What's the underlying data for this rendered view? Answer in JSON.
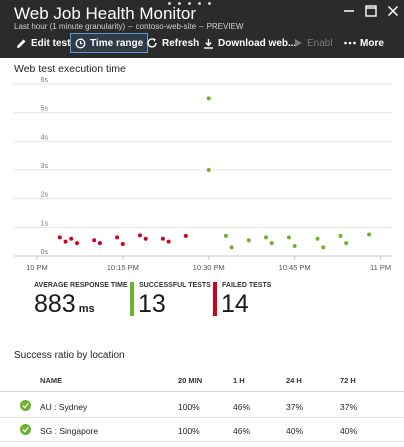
{
  "window": {
    "title": "Web Job Health Monitor",
    "subtitle_range": "Last hour (1 minute granularity)",
    "subtitle_resource": "contoso-web-site",
    "subtitle_tag": "PREVIEW"
  },
  "toolbar": {
    "edit": "Edit test",
    "time_range": "Time range",
    "refresh": "Refresh",
    "download": "Download web...",
    "enable": "Enable",
    "more": "More"
  },
  "chart": {
    "title": "Web test execution time"
  },
  "chart_data": {
    "type": "scatter",
    "title": "Web test execution time",
    "xlabel": "",
    "ylabel": "",
    "x_ticks": [
      "10 PM",
      "10:15 PM",
      "10:30 PM",
      "10:45 PM",
      "11 PM"
    ],
    "y_ticks": [
      "0s",
      "1s",
      "2s",
      "3s",
      "4s",
      "5s",
      "6s"
    ],
    "ylim": [
      0,
      6
    ],
    "grid": true,
    "series": [
      {
        "color": "#d0021b",
        "points": [
          {
            "x": "10:04",
            "y": 0.65
          },
          {
            "x": "10:05",
            "y": 0.5
          },
          {
            "x": "10:06",
            "y": 0.6
          },
          {
            "x": "10:07",
            "y": 0.45
          },
          {
            "x": "10:10",
            "y": 0.55
          },
          {
            "x": "10:11",
            "y": 0.45
          },
          {
            "x": "10:14",
            "y": 0.65
          },
          {
            "x": "10:15",
            "y": 0.42
          },
          {
            "x": "10:18",
            "y": 0.72
          },
          {
            "x": "10:19",
            "y": 0.6
          },
          {
            "x": "10:22",
            "y": 0.6
          },
          {
            "x": "10:23",
            "y": 0.5
          },
          {
            "x": "10:26",
            "y": 0.7
          }
        ]
      },
      {
        "color": "#6ab42d",
        "points": [
          {
            "x": "10:30",
            "y": 5.5
          },
          {
            "x": "10:30",
            "y": 3.0
          },
          {
            "x": "10:33",
            "y": 0.7
          },
          {
            "x": "10:34",
            "y": 0.3
          },
          {
            "x": "10:37",
            "y": 0.55
          },
          {
            "x": "10:40",
            "y": 0.65
          },
          {
            "x": "10:41",
            "y": 0.45
          },
          {
            "x": "10:44",
            "y": 0.65
          },
          {
            "x": "10:45",
            "y": 0.35
          },
          {
            "x": "10:49",
            "y": 0.6
          },
          {
            "x": "10:50",
            "y": 0.3
          },
          {
            "x": "10:53",
            "y": 0.7
          },
          {
            "x": "10:54",
            "y": 0.45
          },
          {
            "x": "10:58",
            "y": 0.75
          }
        ]
      }
    ]
  },
  "tiles": {
    "avg": {
      "label": "AVERAGE RESPONSE TIME",
      "value": "883",
      "unit": "ms"
    },
    "success": {
      "label": "SUCCESSFUL TESTS",
      "value": "13",
      "color": "#6ab42d"
    },
    "failed": {
      "label": "FAILED TESTS",
      "value": "14",
      "color": "#d0021b"
    }
  },
  "locations": {
    "title": "Success ratio by location",
    "columns": [
      "NAME",
      "20 MIN",
      "1 H",
      "24 H",
      "72 H"
    ],
    "rows": [
      {
        "name": "AU : Sydney",
        "m20": "100%",
        "h1": "46%",
        "h24": "37%",
        "h72": "37%"
      },
      {
        "name": "SG : Singapore",
        "m20": "100%",
        "h1": "46%",
        "h24": "40%",
        "h72": "40%"
      }
    ]
  },
  "colors": {
    "header_bg": "#2b2b2b",
    "success": "#6ab42d",
    "failure": "#d0021b",
    "accent": "#5a9ad6"
  }
}
